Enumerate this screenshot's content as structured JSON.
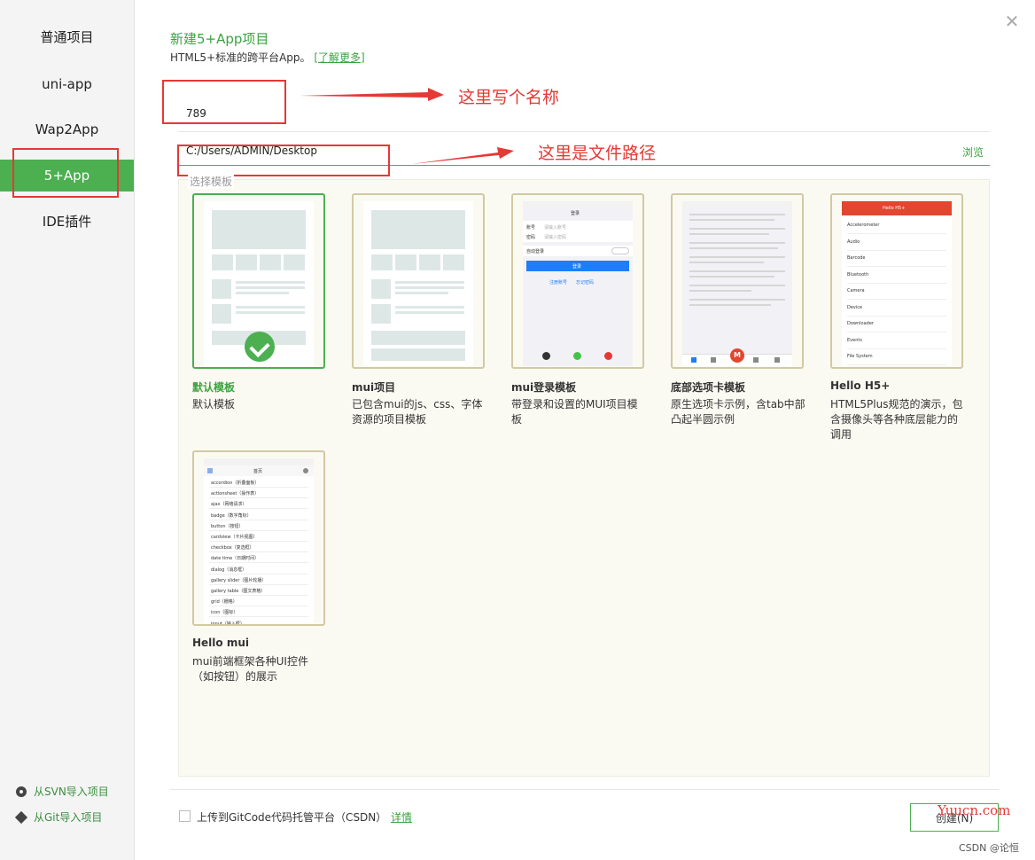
{
  "sidebar": {
    "items": [
      {
        "label": "普通项目"
      },
      {
        "label": "uni-app"
      },
      {
        "label": "Wap2App"
      },
      {
        "label": "5+App"
      },
      {
        "label": "IDE插件"
      }
    ],
    "import_svn": "从SVN导入项目",
    "import_git": "从Git导入项目"
  },
  "header": {
    "title": "新建5+App项目",
    "subtitle": "HTML5+标准的跨平台App。",
    "learn_more": "[了解更多]"
  },
  "form": {
    "name_value": "789",
    "path_value": "C:/Users/ADMIN/Desktop",
    "browse_label": "浏览",
    "template_legend": "选择模板"
  },
  "annotations": {
    "name_note": "这里写个名称",
    "path_note": "这里是文件路径"
  },
  "templates": [
    {
      "name": "默认模板",
      "desc": "默认模板"
    },
    {
      "name": "mui项目",
      "desc": "已包含mui的js、css、字体资源的项目模板"
    },
    {
      "name": "mui登录模板",
      "desc": "带登录和设置的MUI项目模板"
    },
    {
      "name": "底部选项卡模板",
      "desc": "原生选项卡示例，含tab中部凸起半圆示例"
    },
    {
      "name": "Hello H5+",
      "desc": "HTML5Plus规范的演示，包含摄像头等各种底层能力的调用"
    },
    {
      "name": "Hello mui",
      "desc": "mui前端框架各种UI控件（如按钮）的展示"
    }
  ],
  "login_preview": {
    "title": "登录",
    "account": "账号",
    "password": "密码",
    "account_ph": "请输入账号",
    "password_ph": "请输入密码",
    "auto_login": "自动登录",
    "login_btn": "登录",
    "register": "注册账号",
    "forgot": "忘记密码"
  },
  "h5_preview": {
    "title": "Hello H5+",
    "items": [
      "Accelerometer",
      "Audio",
      "Barcode",
      "Bluetooth",
      "Camera",
      "Device",
      "Downloader",
      "Events",
      "File System"
    ]
  },
  "tab_preview": {
    "center": "M"
  },
  "mui_preview": {
    "title": "首页",
    "items": [
      "accordion（折叠面板）",
      "actionsheet（操作表）",
      "ajax（网络请求）",
      "badge（数字角标）",
      "button（按钮）",
      "cardview（卡片视图）",
      "checkbox（复选框）",
      "date time（日期时间）",
      "dialog（消息框）",
      "gallery slider（图片轮播）",
      "gallery table（图文表格）",
      "grid（栅格）",
      "icon（图标）",
      "input（输入框）"
    ]
  },
  "footer": {
    "upload_label": "上传到GitCode代码托管平台（CSDN）",
    "details": "详情",
    "create_button": "创建(N)",
    "watermark": "Yuucn.com",
    "credit": "CSDN @论恒"
  },
  "colors": {
    "accent": "#4caf50",
    "annotation": "#e53935"
  }
}
